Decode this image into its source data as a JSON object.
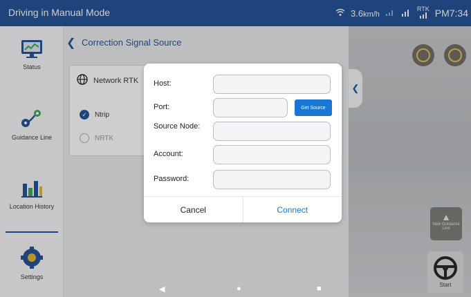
{
  "status_bar": {
    "title": "Driving in Manual Mode",
    "speed_value": "3.6",
    "speed_unit": "km/h",
    "rtk_label": "RTK",
    "time": "PM7:34"
  },
  "sidebar": {
    "items": [
      {
        "label": "Status",
        "icon": "monitor-chart-icon"
      },
      {
        "label": "Guidance Line",
        "icon": "route-pin-icon"
      },
      {
        "label": "Location History",
        "icon": "bar-chart-icon"
      },
      {
        "label": "Settings",
        "icon": "gear-icon"
      }
    ]
  },
  "panel": {
    "title": "Correction Signal Source",
    "source_label": "Network RTK",
    "options": [
      {
        "label": "Ntrip",
        "selected": true
      },
      {
        "label": "NRTK",
        "selected": false
      }
    ]
  },
  "dialog": {
    "fields": [
      {
        "label": "Host:",
        "value": ""
      },
      {
        "label": "Port:",
        "value": ""
      },
      {
        "label": "Source Node:",
        "value": ""
      },
      {
        "label": "Account:",
        "value": ""
      },
      {
        "label": "Password:",
        "value": ""
      }
    ],
    "get_source_label": "Get Source",
    "cancel_label": "Cancel",
    "connect_label": "Connect"
  },
  "map": {
    "new_guidance_label": "New Guidance Line",
    "start_label": "Start"
  },
  "colors": {
    "brand": "#1f4f97",
    "accent": "#1a76d2"
  }
}
